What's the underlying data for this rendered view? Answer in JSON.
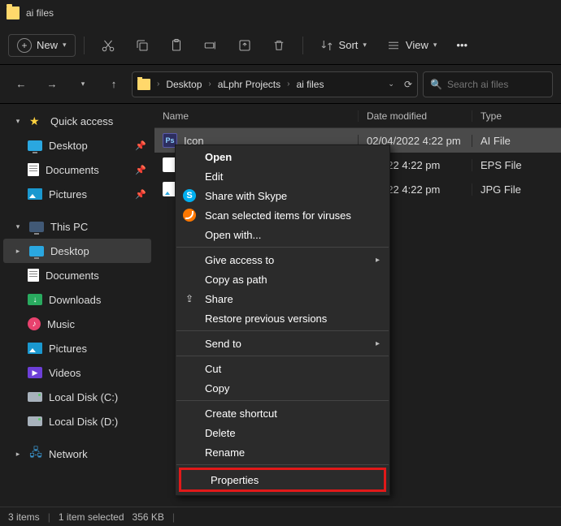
{
  "window": {
    "title": "ai files"
  },
  "toolbar": {
    "new": "New",
    "sort": "Sort",
    "view": "View"
  },
  "breadcrumb": {
    "items": [
      "Desktop",
      "aLphr Projects",
      "ai files"
    ]
  },
  "search": {
    "placeholder": "Search ai files"
  },
  "sidebar": {
    "quickAccess": "Quick access",
    "qa": [
      {
        "label": "Desktop"
      },
      {
        "label": "Documents"
      },
      {
        "label": "Pictures"
      }
    ],
    "thisPC": "This PC",
    "pc": [
      {
        "label": "Desktop"
      },
      {
        "label": "Documents"
      },
      {
        "label": "Downloads"
      },
      {
        "label": "Music"
      },
      {
        "label": "Pictures"
      },
      {
        "label": "Videos"
      },
      {
        "label": "Local Disk (C:)"
      },
      {
        "label": "Local Disk (D:)"
      }
    ],
    "network": "Network"
  },
  "columns": {
    "name": "Name",
    "date": "Date modified",
    "type": "Type"
  },
  "files": [
    {
      "name": "Icon",
      "date": "02/04/2022 4:22 pm",
      "type": "AI File"
    },
    {
      "name": "",
      "date": "4/2022 4:22 pm",
      "type": "EPS File"
    },
    {
      "name": "",
      "date": "4/2022 4:22 pm",
      "type": "JPG File"
    }
  ],
  "context": {
    "open": "Open",
    "edit": "Edit",
    "skype": "Share with Skype",
    "scan": "Scan selected items for viruses",
    "openWith": "Open with...",
    "giveAccess": "Give access to",
    "copyPath": "Copy as path",
    "share": "Share",
    "restore": "Restore previous versions",
    "sendTo": "Send to",
    "cut": "Cut",
    "copy": "Copy",
    "shortcut": "Create shortcut",
    "delete": "Delete",
    "rename": "Rename",
    "properties": "Properties"
  },
  "status": {
    "count": "3 items",
    "selection": "1 item selected",
    "size": "356 KB"
  }
}
